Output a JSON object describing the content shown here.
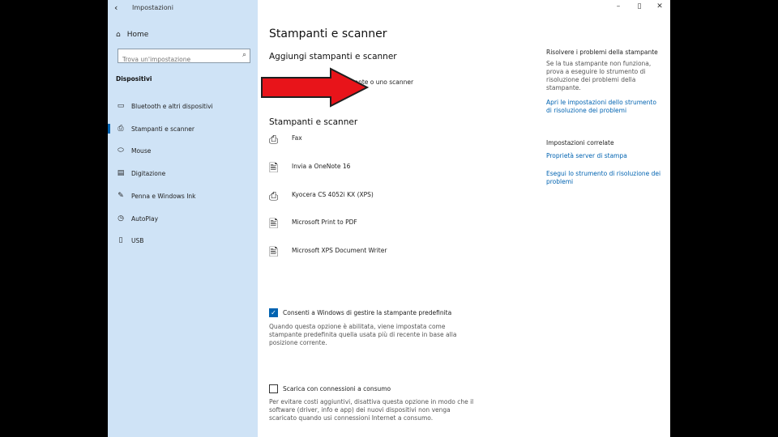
{
  "window": {
    "title": "Impostazioni",
    "back_glyph": "‹",
    "minimize": "–",
    "maximize": "▯",
    "close": "✕"
  },
  "sidebar": {
    "home_label": "Home",
    "search_placeholder": "Trova un'impostazione",
    "section_label": "Dispositivi",
    "items": [
      {
        "label": "Bluetooth e altri dispositivi",
        "icon": "bluetooth-icon"
      },
      {
        "label": "Stampanti e scanner",
        "icon": "printer-icon"
      },
      {
        "label": "Mouse",
        "icon": "mouse-icon"
      },
      {
        "label": "Digitazione",
        "icon": "keyboard-icon"
      },
      {
        "label": "Penna e Windows Ink",
        "icon": "pen-icon"
      },
      {
        "label": "AutoPlay",
        "icon": "autoplay-icon"
      },
      {
        "label": "USB",
        "icon": "usb-icon"
      }
    ]
  },
  "main": {
    "title": "Stampanti e scanner",
    "add_section_title": "Aggiungi stampanti e scanner",
    "add_label": "Aggiungi una stampante o uno scanner",
    "list_title": "Stampanti e scanner",
    "printers": [
      {
        "name": "Fax"
      },
      {
        "name": "Invia a OneNote 16"
      },
      {
        "name": "Kyocera CS 4052i KX (XPS)"
      },
      {
        "name": "Microsoft Print to PDF"
      },
      {
        "name": "Microsoft XPS Document Writer"
      }
    ],
    "default_printer": {
      "checked": true,
      "label": "Consenti a Windows di gestire la stampante predefinita",
      "description": "Quando questa opzione è abilitata, viene impostata come stampante predefinita quella usata più di recente in base alla posizione corrente."
    },
    "metered": {
      "checked": false,
      "label": "Scarica con connessioni a consumo",
      "description": "Per evitare costi aggiuntivi, disattiva questa opzione in modo che il software (driver, info e app) dei nuovi dispositivi non venga scaricato quando usi connessioni Internet a consumo."
    }
  },
  "right_panel": {
    "troubleshoot_title": "Risolvere i problemi della stampante",
    "troubleshoot_text": "Se la tua stampante non funziona, prova a eseguire lo strumento di risoluzione dei problemi della stampante.",
    "troubleshoot_link": "Apri le impostazioni dello strumento di risoluzione dei problemi",
    "related_title": "Impostazioni correlate",
    "related_links": [
      {
        "label": "Proprietà server di stampa"
      },
      {
        "label": "Esegui lo strumento di risoluzione dei problemi"
      }
    ]
  },
  "colors": {
    "sidebar_bg": "#cfe3f6",
    "accent": "#0063b1",
    "arrow_fill": "#e8141a"
  }
}
